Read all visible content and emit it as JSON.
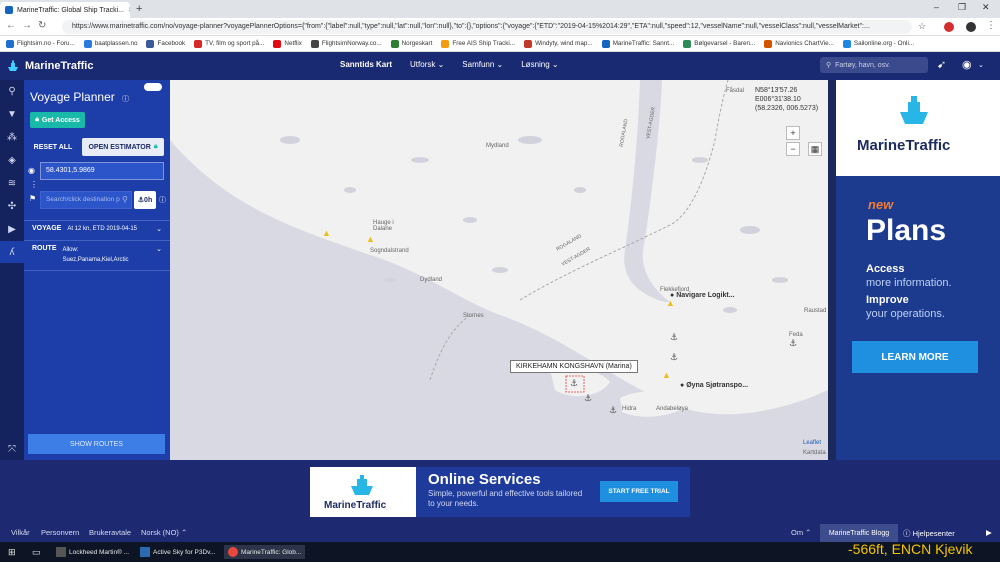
{
  "browser": {
    "tab_title": "MarineTraffic: Global Ship Tracki...",
    "url": "https://www.marinetraffic.com/no/voyage-planner?voyagePlannerOptions={\"from\":{\"label\":null,\"type\":null,\"lat\":null,\"lon\":null},\"to\":{},\"options\":{\"voyage\":{\"ETD\":\"2019-04-15%2014:29\",\"ETA\":null,\"speed\":12,\"vesselName\":null,\"vesselClass\":null,\"vesselMarket\":..."
  },
  "bookmarks": [
    {
      "label": "Flightsim.no - Foru...",
      "color": "#1f6fd1"
    },
    {
      "label": "baatplassen.no",
      "color": "#2a7be0"
    },
    {
      "label": "Facebook",
      "color": "#3b5998"
    },
    {
      "label": "TV, film og sport på...",
      "color": "#d62828"
    },
    {
      "label": "Netflix",
      "color": "#e50914"
    },
    {
      "label": "FlightsimNorway.co...",
      "color": "#444444"
    },
    {
      "label": "Norgeskart",
      "color": "#2e7d32"
    },
    {
      "label": "Free AIS Ship Tracki...",
      "color": "#f39c12"
    },
    {
      "label": "Windyty, wind map...",
      "color": "#c0392b"
    },
    {
      "label": "MarineTraffic: Sannt...",
      "color": "#1565c0"
    },
    {
      "label": "Bølgevarsel - Baren...",
      "color": "#2e8b57"
    },
    {
      "label": "Navionics ChartVie...",
      "color": "#d35400"
    },
    {
      "label": "Sailonline.org - Onli...",
      "color": "#1e88e5"
    }
  ],
  "site": {
    "brand": "MarineTraffic",
    "nav": [
      "Sanntids Kart",
      "Utforsk ⌄",
      "Samfunn ⌄",
      "Løsning ⌄"
    ],
    "search_placeholder": "Fartøy, havn, osv."
  },
  "panel": {
    "title": "Voyage Planner",
    "get_access": "Get Access",
    "reset_all": "RESET ALL",
    "open_estimator": "OPEN ESTIMATOR",
    "from_value": "58.4301,5.9869",
    "to_placeholder": "Search/click destination p",
    "hours": "0h",
    "voyage_label": "VOYAGE",
    "voyage_value": "At 12 kn, ETD 2019-04-15",
    "route_label": "ROUTE",
    "route_allow": "Allow:",
    "route_value": "Suez,Panama,Kiel,Arctic",
    "show_routes": "SHOW ROUTES"
  },
  "map": {
    "coord_lines": [
      "N58°13'57.26",
      "E006°31'38.10",
      "(58.2326, 006.5273)"
    ],
    "places": [
      {
        "name": "Fåsdal"
      },
      {
        "name": "Mydland"
      },
      {
        "name": "Hauge i\nDalane"
      },
      {
        "name": "Sogndalstrand"
      },
      {
        "name": "Dydland"
      },
      {
        "name": "Stornes"
      },
      {
        "name": "Flekkefjord"
      },
      {
        "name": "Andabeløya"
      },
      {
        "name": "Hidra"
      },
      {
        "name": "Feda"
      },
      {
        "name": "Raustad"
      }
    ],
    "region_labels": [
      "ROGALAND",
      "VEST-AGDER",
      "ROGALAND",
      "VEST-AGDER"
    ],
    "vessel_labels": [
      "Navigare Logikt...",
      "Øyna Sjøtranspo..."
    ],
    "tooltip": "KIRKEHAMN KONGSHAVN (Marina)",
    "zoom_in": "+",
    "zoom_out": "−",
    "attribution": "Leaflet",
    "kartdata": "Kartdata"
  },
  "right_ad": {
    "brand": "MarineTraffic",
    "new": "new",
    "plans": "Plans",
    "line1a": "Access",
    "line1b": "more information.",
    "line2a": "Improve",
    "line2b": "your operations.",
    "cta": "LEARN MORE"
  },
  "bottom_banner": {
    "brand": "MarineTraffic",
    "title": "Online Services",
    "subtitle": "Simple, powerful and effective tools tailored to your needs.",
    "cta": "START FREE TRIAL"
  },
  "footer": {
    "links": [
      "Vilkår",
      "Personvern",
      "Brukeravtale",
      "Norsk (NO) ⌃"
    ],
    "om": "Om ⌃",
    "blog": "MarineTraffic Blogg",
    "help": "Hjelpesenter"
  },
  "taskbar": {
    "items": [
      "Lockheed Martin® ...",
      "Active Sky for P3Dv...",
      "MarineTraffic: Glob..."
    ]
  },
  "overlay_text": "-566ft, ENCN Kjevik",
  "colors": {
    "header_bg": "#1a2a72",
    "panel_bg": "#1d3ea8",
    "accent_teal": "#18b9a9",
    "cta_blue": "#1f8fe0",
    "new_orange": "#f07c35",
    "overlay_yellow": "#f5c400"
  }
}
